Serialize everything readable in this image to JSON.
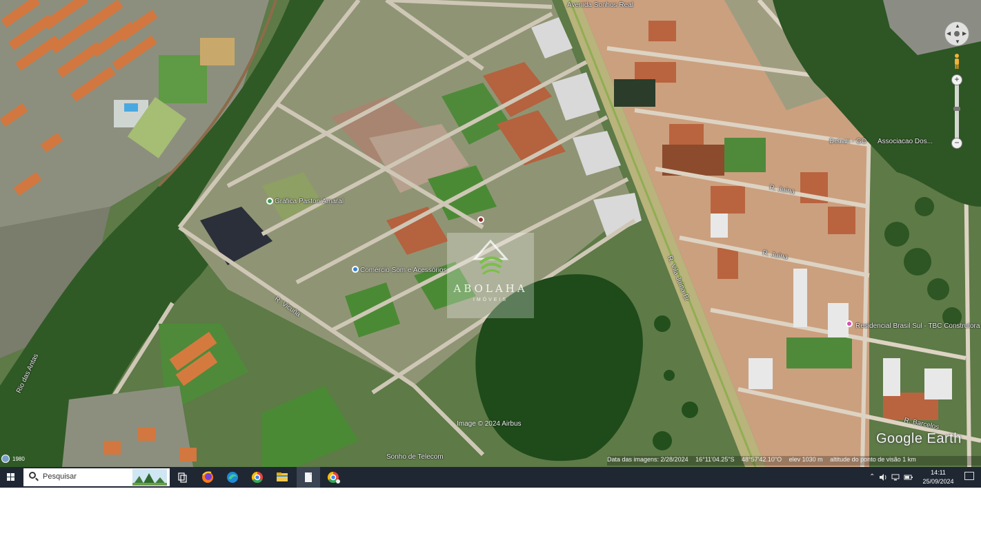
{
  "map": {
    "labels": {
      "place_grafica": "Gráfica Pastori Amaral",
      "place_comercio": "Comércio Som e Acessórios",
      "place_associacao": "Associacao Dos...",
      "place_detran": "Detran - GO",
      "place_residencial": "Residencial Brasil Sul - TBC Construtora",
      "place_telecom": "Sonho de Telecom",
      "street_rio": "Rio das Antas",
      "street_top": "Avenida Sonhos Real",
      "street_diag": "R. Vila Juína-Br",
      "street_r1": "R. Juína",
      "street_r2": "R. Juína",
      "street_r3": "R. Barcelos",
      "street_left": "R. Vicuña"
    },
    "watermark": {
      "word": "ABOLAHA",
      "sub": "IMÓVEIS"
    },
    "image_credit": "Image © 2024 Airbus",
    "google_earth": "Google Earth",
    "status": {
      "date": "Data das imagens: 2/28/2024",
      "lat": "16°11'04.25\"S",
      "lon": "48°57'42.10\"O",
      "elev": "elev 1030 m",
      "eye": "altitude do ponto de visão 1 km"
    },
    "scale": "1980"
  },
  "taskbar": {
    "search_placeholder": "Pesquisar",
    "apps": [
      "task-view",
      "firefox",
      "edge",
      "chrome",
      "file-explorer",
      "document",
      "chrome-profile"
    ],
    "tray_icons": [
      "chevron-up-icon",
      "speaker-icon",
      "network-icon",
      "battery-icon"
    ],
    "time": "14:11",
    "date": "25/09/2024"
  },
  "colors": {
    "taskbar": "#1f2733",
    "vegetation": "#2f5a25",
    "soil": "#b5623f",
    "road": "#cfc7b6"
  }
}
